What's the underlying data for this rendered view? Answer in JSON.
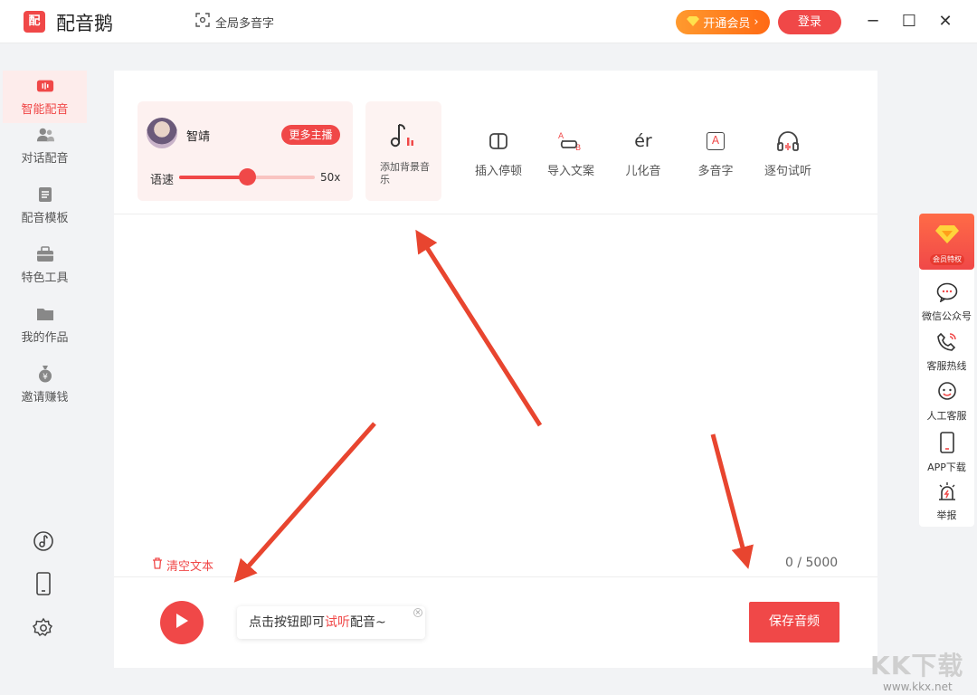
{
  "app": {
    "name": "配音鹅",
    "logo_text": "配"
  },
  "titlebar": {
    "global_polyphone": "全局多音字",
    "vip_button": "开通会员",
    "vip_chevron": "›",
    "login_button": "登录",
    "minimize": "─",
    "maximize": "☐",
    "close": "✕"
  },
  "sidebar": {
    "items": [
      {
        "label": "智能配音",
        "icon": "smart-dubbing-icon",
        "active": true
      },
      {
        "label": "对话配音",
        "icon": "dialogue-icon"
      },
      {
        "label": "配音模板",
        "icon": "template-icon"
      },
      {
        "label": "特色工具",
        "icon": "toolbox-icon"
      },
      {
        "label": "我的作品",
        "icon": "folder-icon"
      },
      {
        "label": "邀请赚钱",
        "icon": "money-bag-icon"
      }
    ],
    "bottom_icons": [
      "music-note-circle-icon",
      "phone-device-icon",
      "settings-gear-icon"
    ]
  },
  "voice_card": {
    "name": "智靖",
    "more_button": "更多主播",
    "speed_label": "语速",
    "speed_value": "50x",
    "speed_fraction": 0.5
  },
  "bg_music": {
    "label": "添加背景音乐"
  },
  "tools": [
    {
      "label": "插入停顿",
      "icon": "pause-insert-icon"
    },
    {
      "label": "导入文案",
      "icon": "import-text-icon"
    },
    {
      "label": "儿化音",
      "icon": "erhua-icon",
      "glyph": "ér"
    },
    {
      "label": "多音字",
      "icon": "polyphone-icon",
      "glyph": "A"
    },
    {
      "label": "逐句试听",
      "icon": "headphones-icon"
    }
  ],
  "editor": {
    "clear_text": "清空文本",
    "char_count": "0 / 5000"
  },
  "player": {
    "tip_prefix": "点击按钮即可",
    "tip_highlight": "试听",
    "tip_suffix": "配音~",
    "save_button": "保存音频"
  },
  "right_bar": {
    "vip_label": "会员特权",
    "items": [
      {
        "label": "微信公众号",
        "icon": "wechat-chat-icon"
      },
      {
        "label": "客服热线",
        "icon": "phone-hotline-icon"
      },
      {
        "label": "人工客服",
        "icon": "customer-service-icon"
      },
      {
        "label": "APP下载",
        "icon": "mobile-app-icon"
      },
      {
        "label": "举报",
        "icon": "report-alarm-icon"
      }
    ]
  },
  "watermark": {
    "title": "KK下载",
    "url": "www.kkx.net"
  },
  "colors": {
    "accent": "#f04848",
    "vip_orange": "#ff7a1a",
    "arrow": "#e8452f"
  }
}
